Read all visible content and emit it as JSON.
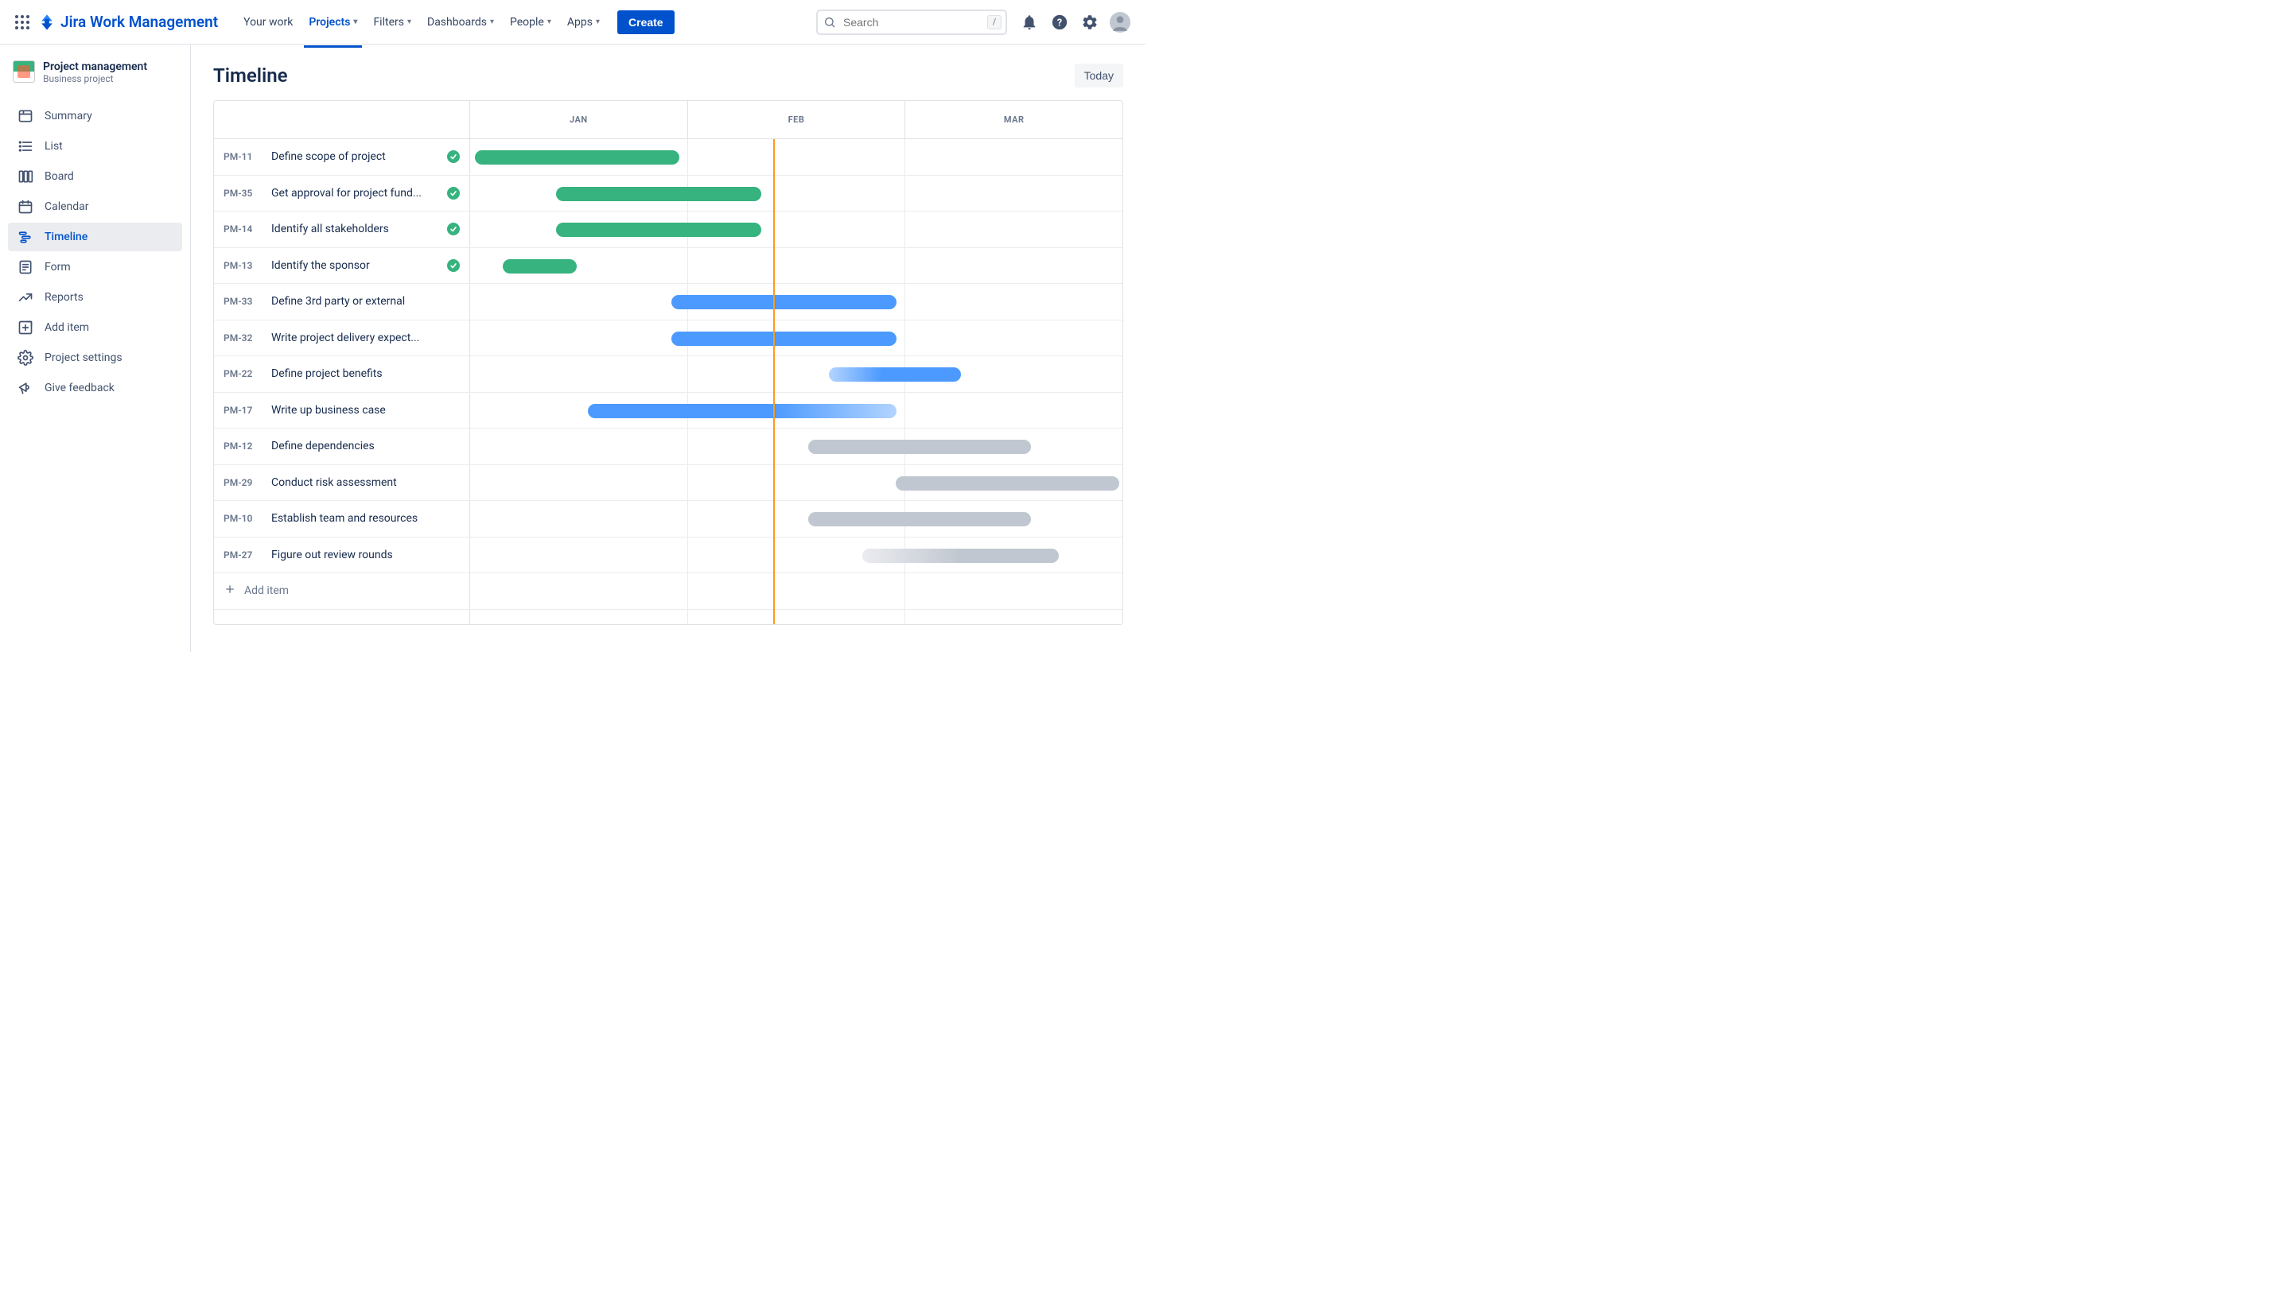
{
  "brand": "Jira Work Management",
  "topnav": {
    "items": [
      "Your work",
      "Projects",
      "Filters",
      "Dashboards",
      "People",
      "Apps"
    ],
    "active_index": 1,
    "create": "Create",
    "search_placeholder": "Search",
    "search_shortcut": "/"
  },
  "project": {
    "name": "Project management",
    "type": "Business project"
  },
  "sidebar": {
    "items": [
      {
        "label": "Summary",
        "icon": "summary"
      },
      {
        "label": "List",
        "icon": "list"
      },
      {
        "label": "Board",
        "icon": "board"
      },
      {
        "label": "Calendar",
        "icon": "calendar"
      },
      {
        "label": "Timeline",
        "icon": "timeline",
        "active": true
      },
      {
        "label": "Form",
        "icon": "form"
      },
      {
        "label": "Reports",
        "icon": "reports"
      },
      {
        "label": "Add item",
        "icon": "additem"
      },
      {
        "label": "Project settings",
        "icon": "settings"
      },
      {
        "label": "Give feedback",
        "icon": "feedback"
      }
    ]
  },
  "page": {
    "title": "Timeline",
    "today_btn": "Today"
  },
  "timeline": {
    "months": [
      "JAN",
      "FEB",
      "MAR"
    ],
    "today_position_pct": 46.5,
    "add_item_label": "Add item",
    "rows": [
      {
        "key": "PM-11",
        "summary": "Define scope of project",
        "done": true,
        "bar": {
          "left_pct": 0.7,
          "width_pct": 31.4,
          "style": "green"
        }
      },
      {
        "key": "PM-35",
        "summary": "Get approval for project fund...",
        "done": true,
        "bar": {
          "left_pct": 13.2,
          "width_pct": 31.4,
          "style": "green"
        }
      },
      {
        "key": "PM-14",
        "summary": "Identify all stakeholders",
        "done": true,
        "bar": {
          "left_pct": 13.2,
          "width_pct": 31.4,
          "style": "green"
        }
      },
      {
        "key": "PM-13",
        "summary": "Identify the sponsor",
        "done": true,
        "bar": {
          "left_pct": 5.0,
          "width_pct": 11.3,
          "style": "green"
        }
      },
      {
        "key": "PM-33",
        "summary": "Define 3rd party or external",
        "done": false,
        "bar": {
          "left_pct": 30.8,
          "width_pct": 34.6,
          "style": "blue"
        }
      },
      {
        "key": "PM-32",
        "summary": "Write project delivery expect...",
        "done": false,
        "bar": {
          "left_pct": 30.8,
          "width_pct": 34.6,
          "style": "blue"
        }
      },
      {
        "key": "PM-22",
        "summary": "Define project benefits",
        "done": false,
        "bar": {
          "left_pct": 55.0,
          "width_pct": 20.3,
          "style": "blue-grad"
        }
      },
      {
        "key": "PM-17",
        "summary": "Write up business case",
        "done": false,
        "bar": {
          "left_pct": 18.1,
          "width_pct": 47.3,
          "style": "blue-fade"
        }
      },
      {
        "key": "PM-12",
        "summary": "Define dependencies",
        "done": false,
        "bar": {
          "left_pct": 51.8,
          "width_pct": 34.2,
          "style": "gray"
        }
      },
      {
        "key": "PM-29",
        "summary": "Conduct risk assessment",
        "done": false,
        "bar": {
          "left_pct": 65.2,
          "width_pct": 34.3,
          "style": "gray"
        }
      },
      {
        "key": "PM-10",
        "summary": "Establish team and resources",
        "done": false,
        "bar": {
          "left_pct": 51.8,
          "width_pct": 34.2,
          "style": "gray"
        }
      },
      {
        "key": "PM-27",
        "summary": "Figure out review rounds",
        "done": false,
        "bar": {
          "left_pct": 60.1,
          "width_pct": 30.1,
          "style": "gray-grad"
        }
      }
    ]
  }
}
